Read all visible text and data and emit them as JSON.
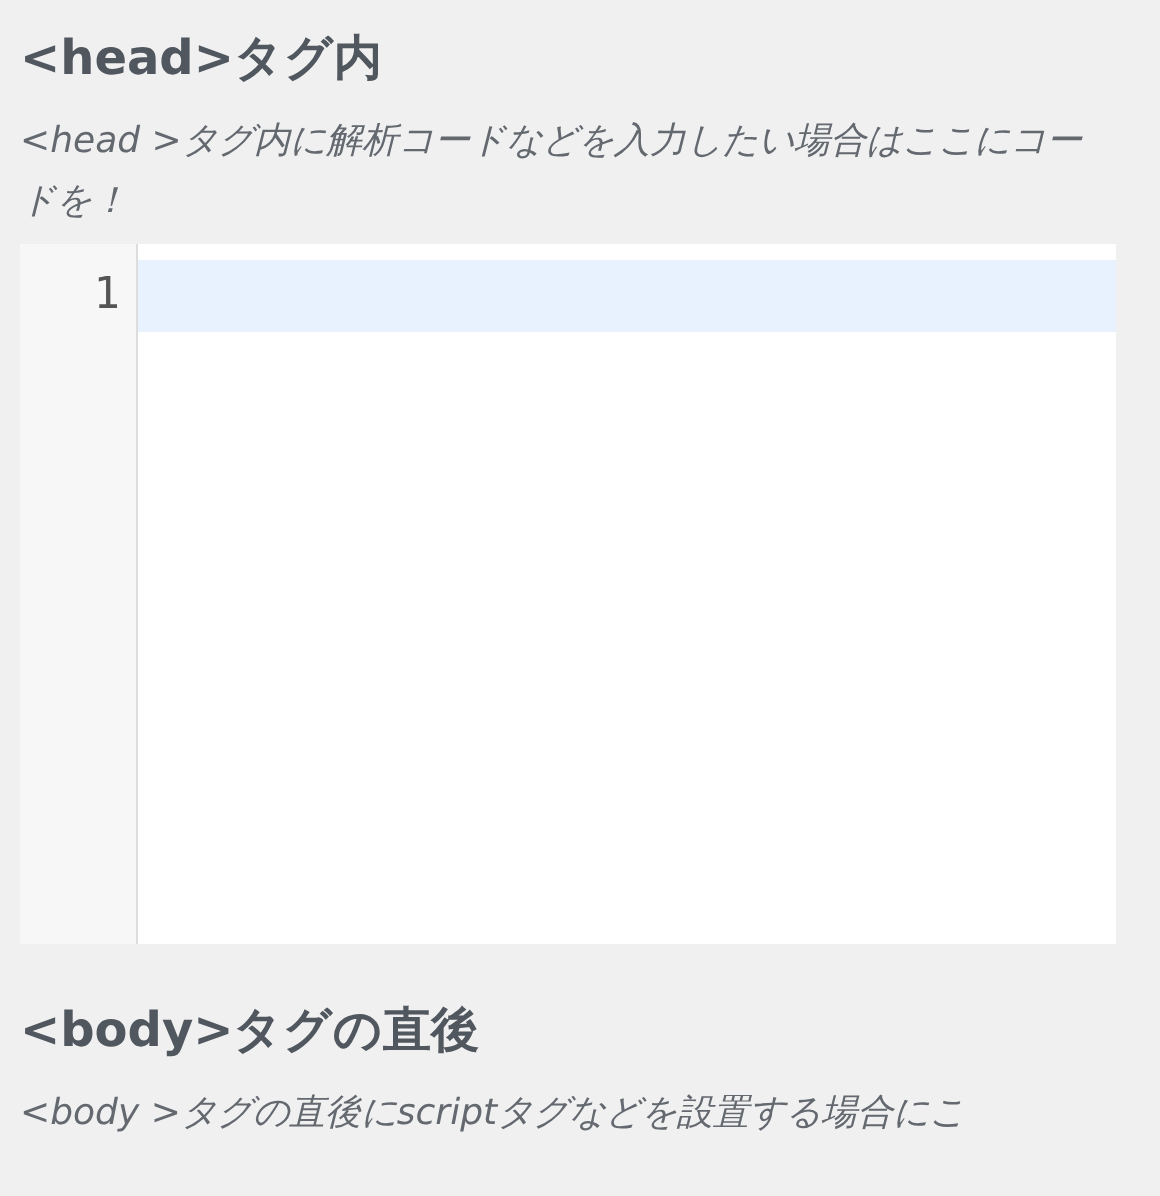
{
  "sections": [
    {
      "heading": "<head>タグ内",
      "description": "<head >タグ内に解析コードなどを入力したい場合はここにコードを！",
      "editor": {
        "line_numbers": [
          "1"
        ]
      }
    },
    {
      "heading": "<body>タグの直後",
      "description": "<body >タグの直後にscriptタグなどを設置する場合にこ"
    }
  ]
}
